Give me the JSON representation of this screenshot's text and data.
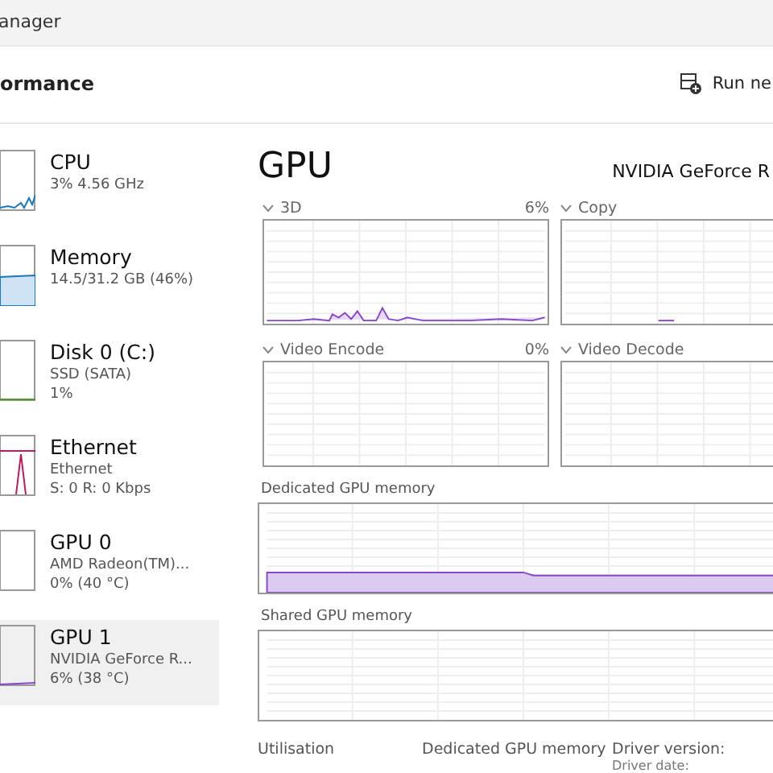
{
  "window": {
    "title": "anager"
  },
  "header": {
    "title": "ormance",
    "action": "Run ne"
  },
  "sidebar": {
    "items": [
      {
        "kind": "cpu",
        "name": "CPU",
        "lines": [
          "3% 4.56 GHz"
        ],
        "selected": false
      },
      {
        "kind": "memory",
        "name": "Memory",
        "lines": [
          "14.5/31.2 GB (46%)"
        ],
        "selected": false
      },
      {
        "kind": "disk",
        "name": "Disk 0 (C:)",
        "lines": [
          "SSD (SATA)",
          "1%"
        ],
        "selected": false
      },
      {
        "kind": "ethernet",
        "name": "Ethernet",
        "lines": [
          "Ethernet",
          "S: 0 R: 0 Kbps"
        ],
        "selected": false
      },
      {
        "kind": "idle",
        "name": "GPU 0",
        "lines": [
          "AMD Radeon(TM)...",
          "0% (40 °C)"
        ],
        "selected": false
      },
      {
        "kind": "gpu",
        "name": "GPU 1",
        "lines": [
          "NVIDIA GeForce R...",
          "6% (38 °C)"
        ],
        "selected": true
      }
    ]
  },
  "main": {
    "title": "GPU",
    "device": "NVIDIA GeForce R",
    "engines": [
      {
        "label": "3D",
        "value": "6%",
        "kind": "active"
      },
      {
        "label": "Copy",
        "kind": "flat"
      },
      {
        "label": "Video Encode",
        "value": "0%",
        "kind": "empty"
      },
      {
        "label": "Video Decode",
        "kind": "empty"
      }
    ],
    "memory_graphs": [
      {
        "label": "Dedicated GPU memory",
        "kind": "filled"
      },
      {
        "label": "Shared GPU memory",
        "kind": "empty"
      }
    ],
    "stats": [
      {
        "label": "Utilisation"
      },
      {
        "label": "Dedicated GPU memory"
      },
      {
        "label": "Driver version:",
        "extra": "Driver date:"
      }
    ]
  }
}
